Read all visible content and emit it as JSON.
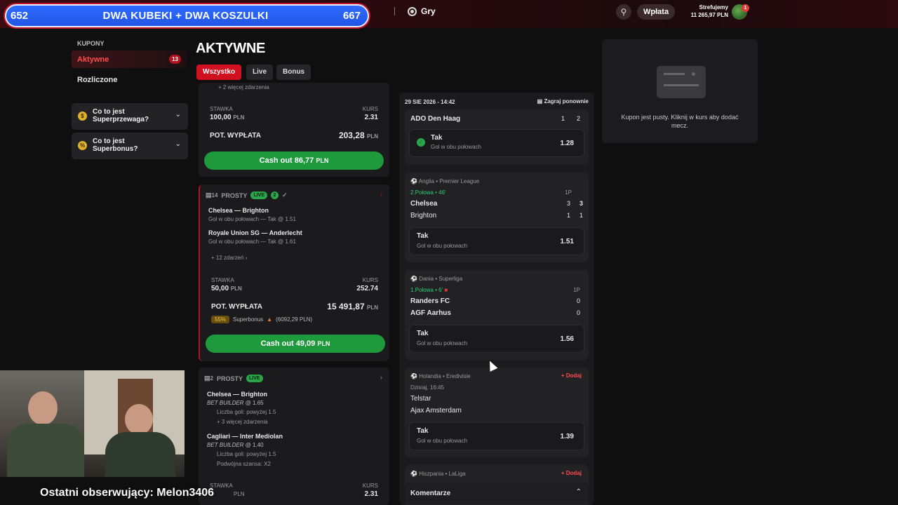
{
  "overlay": {
    "left_count": "652",
    "title": "DWA KUBEKI + DWA KOSZULKI",
    "right_count": "667"
  },
  "header": {
    "games_label": "Gry",
    "deposit_label": "Wpłata",
    "username": "Strefujemy",
    "balance": "11 265,97 PLN",
    "notification_count": "1"
  },
  "sidebar": {
    "section_label": "KUPONY",
    "items": [
      {
        "label": "Aktywne",
        "badge": "13"
      },
      {
        "label": "Rozliczone"
      }
    ],
    "faq": [
      {
        "label": "Co to jest Superprzewaga?"
      },
      {
        "label": "Co to jest Superbonus?"
      }
    ]
  },
  "main": {
    "title": "AKTYWNE",
    "tabs": [
      {
        "label": "Wszystko"
      },
      {
        "label": "Live"
      },
      {
        "label": "Bonus"
      }
    ]
  },
  "coupons": [
    {
      "more_events": "+ 2 więcej zdarzenia",
      "stake_label": "STAWKA",
      "stake": "100,00",
      "currency": "PLN",
      "odds_label": "KURS",
      "odds": "2.31",
      "payout_label": "POT. WYPŁATA",
      "payout": "203,28",
      "cashout_label": "Cash out",
      "cashout_value": "86,77"
    },
    {
      "count": "14",
      "type": "PROSTY",
      "live": "LIVE",
      "live_count": "2",
      "events": [
        {
          "teams": "Chelsea — Brighton",
          "market": "Gol w obu połowach — Tak @ 1.51"
        },
        {
          "teams": "Royale Union SG — Anderlecht",
          "market": "Gol w obu połowach — Tak @ 1.61"
        }
      ],
      "more_events": "+ 12 zdarzeń",
      "stake_label": "STAWKA",
      "stake": "50,00",
      "currency": "PLN",
      "odds_label": "KURS",
      "odds": "252.74",
      "payout_label": "POT. WYPŁATA",
      "payout": "15 491,87",
      "superbonus_pct": "55%",
      "superbonus_label": "Superbonus",
      "superbonus_value": "(6092,29 PLN)",
      "cashout_label": "Cash out",
      "cashout_value": "49,09"
    },
    {
      "count": "2",
      "type": "PROSTY",
      "live": "LIVE",
      "events": [
        {
          "teams": "Chelsea — Brighton",
          "builder": "BET BUILDER",
          "odds": "@ 1.65",
          "lines": [
            "Liczba goli: powyżej 1.5",
            "+ 3 więcej zdarzenia"
          ]
        },
        {
          "teams": "Cagliari — Inter Mediolan",
          "builder": "BET BUILDER",
          "odds": "@ 1.40",
          "lines": [
            "Liczba goli: powyżej 1.5",
            "Podwójna szansa: X2"
          ]
        }
      ],
      "stake_label": "STAWKA",
      "currency": "PLN",
      "odds_label": "KURS",
      "odds": "2.31"
    }
  ],
  "detail": {
    "date": "29 SIE 2026 - 14:42",
    "replay_label": "Zagraj ponownie",
    "top_event": {
      "team": "ADO Den Haag",
      "s1": "1",
      "s2": "2",
      "pick": "Tak",
      "market": "Gol w obu połowach",
      "odds": "1.28"
    },
    "events": [
      {
        "league": "Anglia • Premier League",
        "status": "2.Połowa • 46'",
        "period": "1P",
        "home": "Chelsea",
        "away": "Brighton",
        "home_s": "3",
        "home_p": "3",
        "away_s": "1",
        "away_p": "1",
        "pick": "Tak",
        "market": "Gol w obu połowach",
        "odds": "1.51"
      },
      {
        "league": "Dania • Superliga",
        "status": "1.Połowa • 6'",
        "period": "1P",
        "home": "Randers FC",
        "away": "AGF Aarhus",
        "home_s": "0",
        "away_s": "0",
        "pick": "Tak",
        "market": "Gol w obu połowach",
        "odds": "1.56"
      },
      {
        "league": "Holandia • Eredivisie",
        "status": "Dzisiaj, 16:45",
        "add": "+ Dodaj",
        "home": "Telstar",
        "away": "Ajax Amsterdam",
        "pick": "Tak",
        "market": "Gol w obu połowach",
        "odds": "1.39"
      },
      {
        "league": "Hiszpania • LaLiga",
        "add": "+ Dodaj"
      }
    ],
    "comments_label": "Komentarze"
  },
  "empty_coupon": {
    "text": "Kupon jest pusty. Kliknij w kurs aby dodać mecz."
  },
  "stream": {
    "follower_text": "Ostatni obserwujący: Melon3406"
  },
  "colors": {
    "accent": "#d0101e",
    "green": "#1e9a3c",
    "background": "#0f0f10"
  }
}
